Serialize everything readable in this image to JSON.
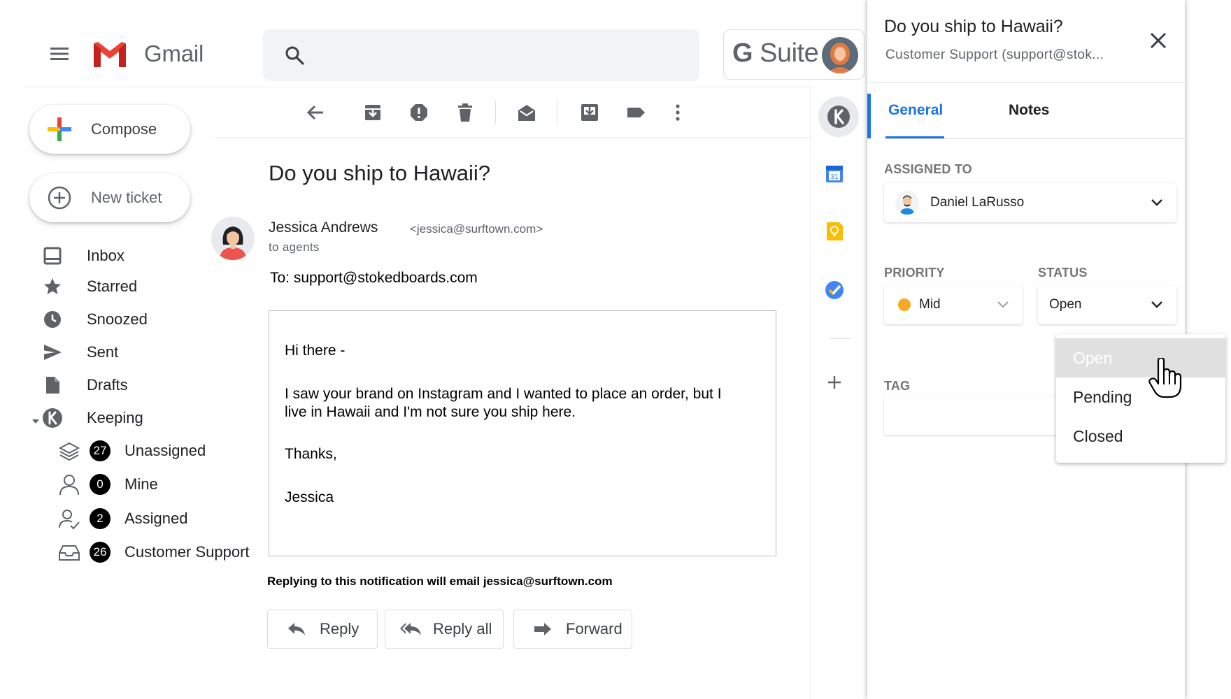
{
  "header": {
    "app_name": "Gmail",
    "suite_name": "Suite",
    "suite_letter": "G"
  },
  "nav": {
    "compose_label": "Compose",
    "new_ticket_label": "New ticket",
    "items": [
      {
        "label": "Inbox",
        "icon": "inbox-icon"
      },
      {
        "label": "Starred",
        "icon": "star-icon"
      },
      {
        "label": "Snoozed",
        "icon": "clock-icon"
      },
      {
        "label": "Sent",
        "icon": "send-icon"
      },
      {
        "label": "Drafts",
        "icon": "draft-icon"
      },
      {
        "label": "Keeping",
        "icon": "keeping-logo-icon"
      }
    ],
    "sub_items": [
      {
        "label": "Unassigned",
        "count": "27",
        "icon": "layers-icon"
      },
      {
        "label": "Mine",
        "count": "0",
        "icon": "person-icon"
      },
      {
        "label": "Assigned",
        "count": "2",
        "icon": "person-check-icon"
      },
      {
        "label": "Customer Support",
        "count": "26",
        "icon": "tray-icon"
      }
    ]
  },
  "email": {
    "subject": "Do you ship to Hawaii?",
    "sender_name": "Jessica Andrews",
    "sender_email": "<jessica@surftown.com>",
    "to_group": "to agents",
    "to_line": "To: support@stokedboards.com",
    "body": {
      "greeting": "Hi there -",
      "paragraph": "I saw your brand on Instagram and I wanted to place an order, but I live in Hawaii and I'm not sure you ship here.",
      "closing": "Thanks,",
      "signature": "Jessica"
    },
    "notice": "Replying to this notification will email jessica@surftown.com",
    "actions": {
      "reply": "Reply",
      "reply_all": "Reply all",
      "forward": "Forward"
    }
  },
  "panel": {
    "title": "Do you ship to Hawaii?",
    "subtitle": "Customer Support (support@stok...",
    "tabs": {
      "general": "General",
      "notes": "Notes"
    },
    "assigned_to_label": "ASSIGNED TO",
    "assignee": "Daniel LaRusso",
    "priority_label": "PRIORITY",
    "priority_value": "Mid",
    "status_label": "STATUS",
    "status_value": "Open",
    "tag_label": "TAG",
    "status_options": [
      "Open",
      "Pending",
      "Closed"
    ]
  },
  "colors": {
    "accent_blue": "#1a73e8",
    "priority_mid": "#f9a825",
    "gmail_red": "#ea4335"
  }
}
